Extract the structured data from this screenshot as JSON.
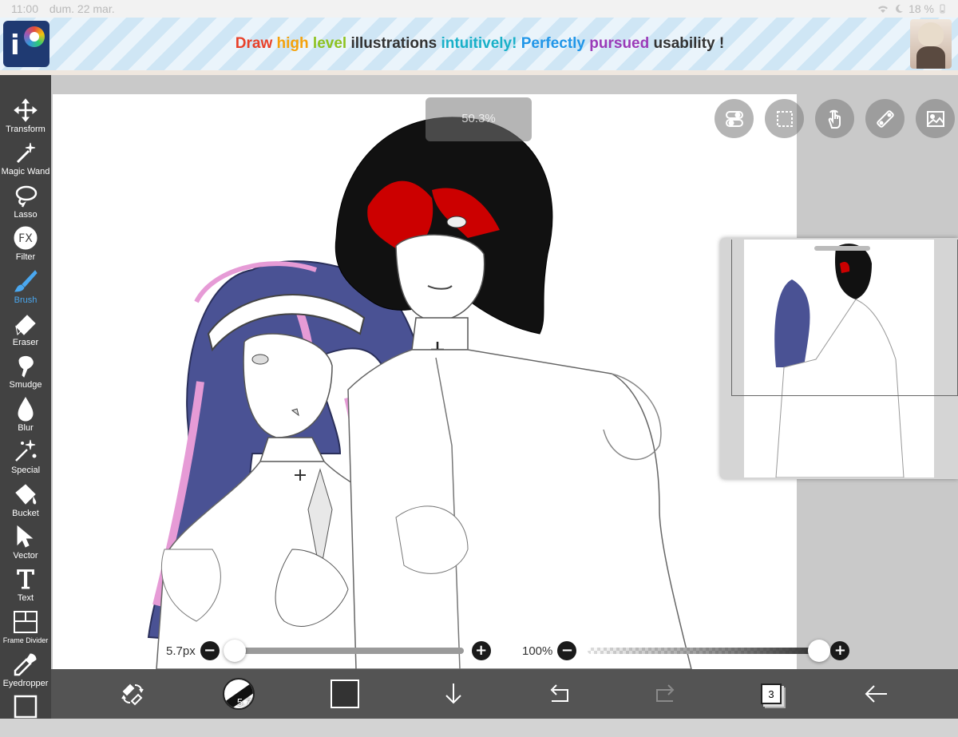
{
  "status_bar": {
    "time": "11:00",
    "date": "dum. 22 mar.",
    "battery": "18 %"
  },
  "banner": {
    "words": [
      {
        "text": "Draw",
        "color": "#e8412a"
      },
      {
        "text": "high",
        "color": "#f5a20b"
      },
      {
        "text": "level",
        "color": "#8ec21f"
      },
      {
        "text": "illustrations",
        "color": "#333333"
      },
      {
        "text": "intuitively!",
        "color": "#19b0c8"
      },
      {
        "text": "Perfectly",
        "color": "#2196e8"
      },
      {
        "text": "pursued",
        "color": "#9b3bb8"
      },
      {
        "text": "usability",
        "color": "#333333"
      },
      {
        "text": "!",
        "color": "#333333"
      }
    ]
  },
  "sidebar": {
    "tools": [
      {
        "label": "Transform",
        "icon": "move-arrows-icon"
      },
      {
        "label": "Magic Wand",
        "icon": "magic-wand-icon"
      },
      {
        "label": "Lasso",
        "icon": "lasso-icon"
      },
      {
        "label": "Filter",
        "icon": "fx-icon"
      },
      {
        "label": "Brush",
        "icon": "brush-icon",
        "active": true
      },
      {
        "label": "Eraser",
        "icon": "eraser-icon"
      },
      {
        "label": "Smudge",
        "icon": "smudge-icon"
      },
      {
        "label": "Blur",
        "icon": "drop-icon"
      },
      {
        "label": "Special",
        "icon": "sparkle-icon"
      },
      {
        "label": "Bucket",
        "icon": "bucket-icon"
      },
      {
        "label": "Vector",
        "icon": "cursor-icon"
      },
      {
        "label": "Text",
        "icon": "text-icon"
      },
      {
        "label": "Frame Divider",
        "icon": "frame-divider-icon"
      },
      {
        "label": "Eyedropper",
        "icon": "eyedropper-icon"
      },
      {
        "label": "",
        "icon": "canvas-icon"
      }
    ]
  },
  "canvas": {
    "zoom": "50.3%"
  },
  "top_buttons": [
    "toggle-icon",
    "selection-icon",
    "hand-icon",
    "ruler-icon",
    "reference-image-icon"
  ],
  "sliders": {
    "size": {
      "label": "5.7px",
      "fraction": 0.03
    },
    "opacity": {
      "label": "100%",
      "fraction": 1.0
    }
  },
  "bottom_bar": {
    "brush_size": "5.7",
    "color": "#333333",
    "layer_count": "3",
    "icons": [
      "swap-eraser-icon",
      "brush-preview",
      "color-swatch",
      "download-icon",
      "undo-icon",
      "redo-icon",
      "layers-icon",
      "back-arrow-icon"
    ]
  }
}
